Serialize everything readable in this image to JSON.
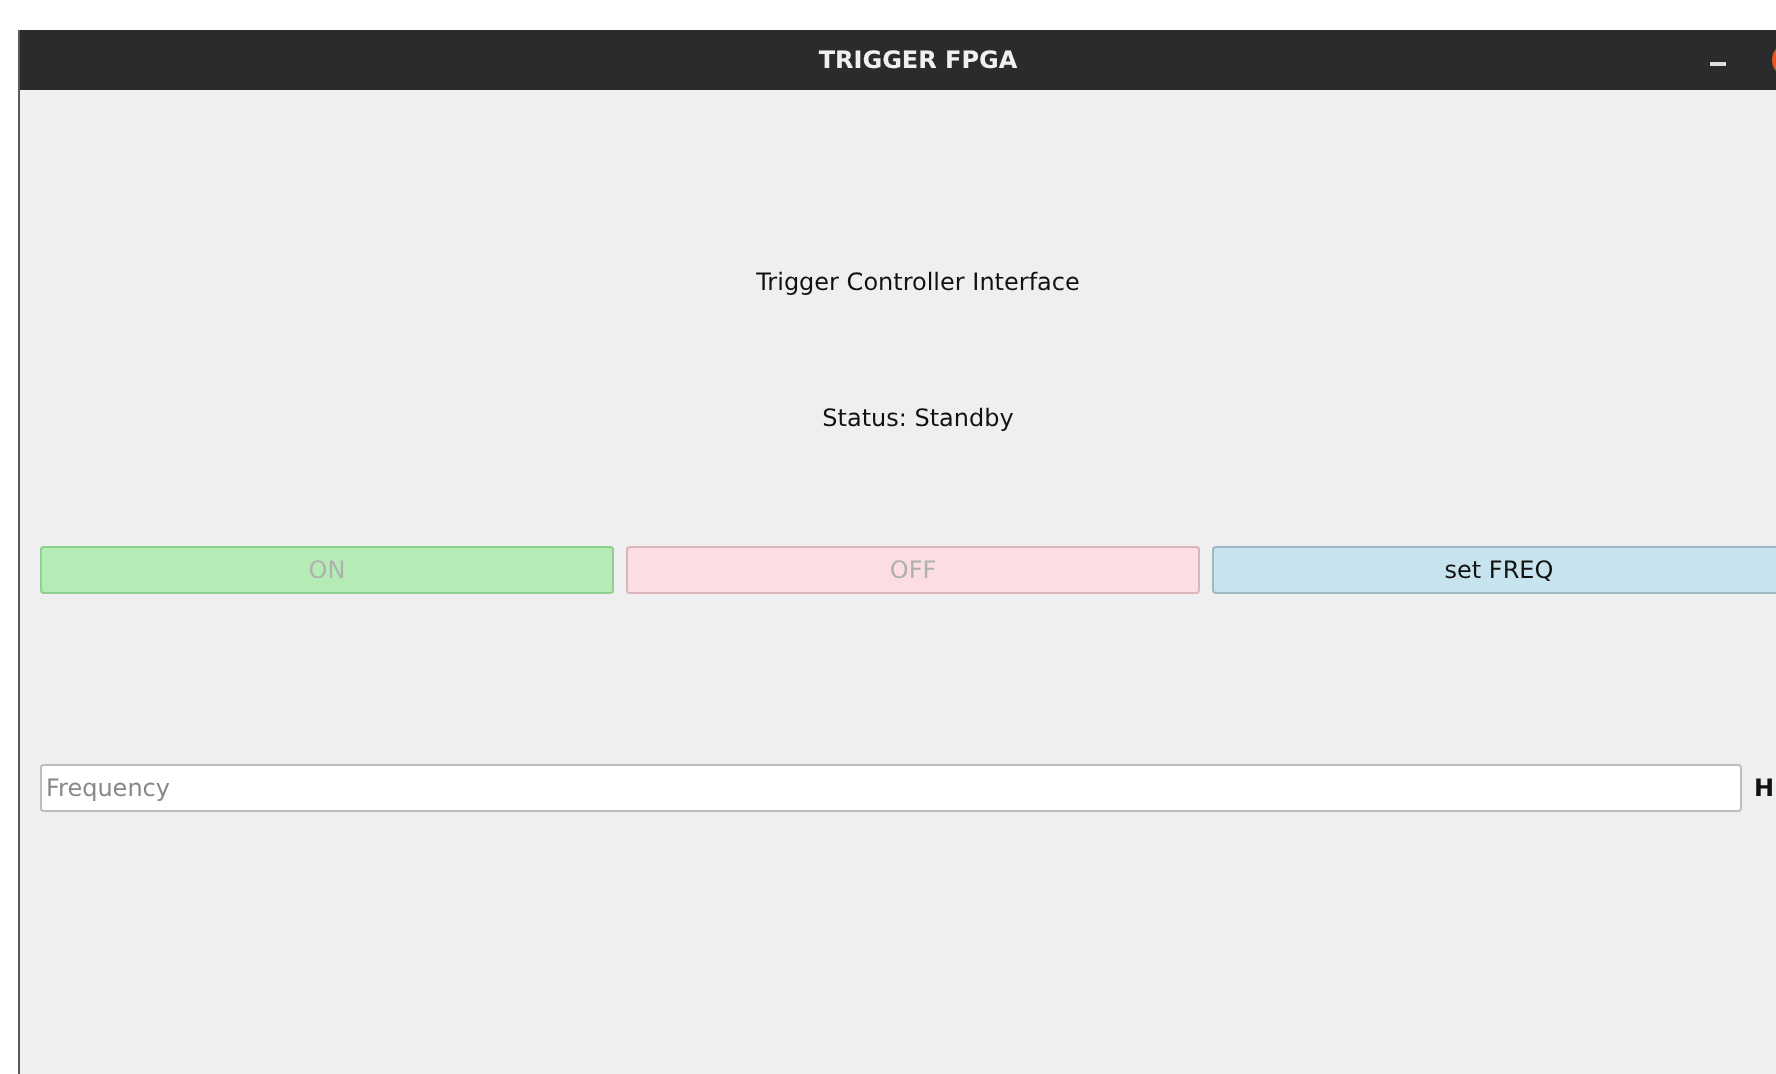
{
  "window": {
    "title": "TRIGGER FPGA"
  },
  "heading": "Trigger Controller Interface",
  "status": "Status: Standby",
  "buttons": [
    {
      "label": "ON",
      "disabled": true,
      "kind": "on"
    },
    {
      "label": "OFF",
      "disabled": true,
      "kind": "off"
    },
    {
      "label": "set FREQ",
      "disabled": false,
      "kind": "freq"
    }
  ],
  "frequency": {
    "placeholder": "Frequency",
    "unit": "H"
  }
}
